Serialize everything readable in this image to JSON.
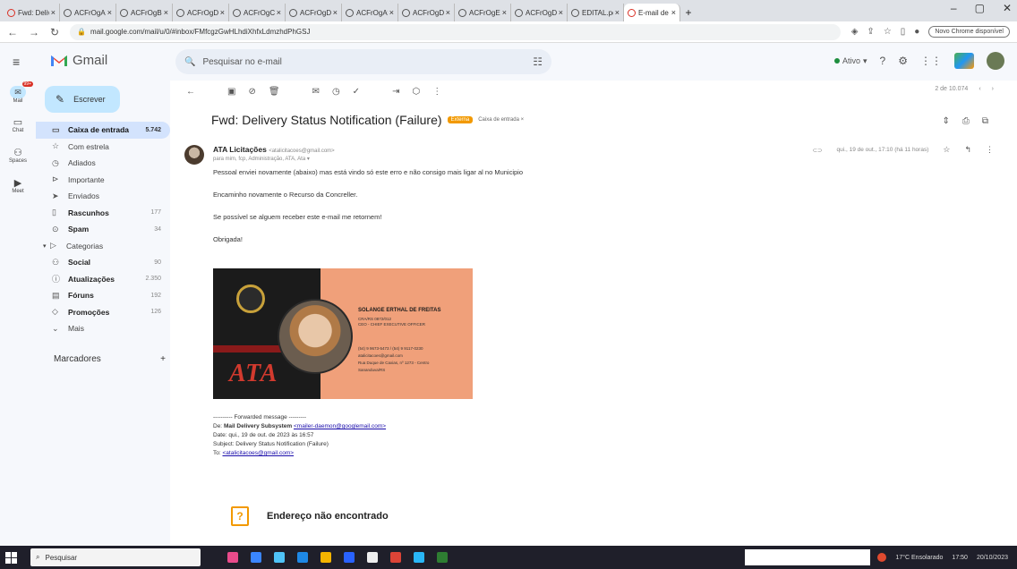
{
  "browser": {
    "tabs": [
      {
        "label": "Fwd: Deliv",
        "icon": "gmail",
        "active": false
      },
      {
        "label": "ACFrOgA7u",
        "icon": "chrome",
        "active": false
      },
      {
        "label": "ACFrOgBe8",
        "icon": "chrome",
        "active": false
      },
      {
        "label": "ACFrOgDsl",
        "icon": "chrome",
        "active": false
      },
      {
        "label": "ACFrOgCsi",
        "icon": "chrome",
        "active": false
      },
      {
        "label": "ACFrOgDxc",
        "icon": "chrome",
        "active": false
      },
      {
        "label": "ACFrOgAfyl",
        "icon": "chrome",
        "active": false
      },
      {
        "label": "ACFrOgDal",
        "icon": "chrome",
        "active": false
      },
      {
        "label": "ACFrOgE6-",
        "icon": "chrome",
        "active": false
      },
      {
        "label": "ACFrOgDfS",
        "icon": "chrome",
        "active": false
      },
      {
        "label": "EDITAL.pdf",
        "icon": "chrome",
        "active": false
      },
      {
        "label": "E-mail de F",
        "icon": "gmail",
        "active": true
      }
    ],
    "url": "mail.google.com/mail/u/0/#inbox/FMfcgzGwHLhdiXhfxLdmzhdPhGSJ",
    "update_label": "Novo Chrome disponível"
  },
  "gmail": {
    "app_name": "Gmail",
    "search_placeholder": "Pesquisar no e-mail",
    "status_label": "Ativo",
    "rail": [
      {
        "label": "Mail",
        "badge": "99+"
      },
      {
        "label": "Chat"
      },
      {
        "label": "Spaces"
      },
      {
        "label": "Meet"
      }
    ],
    "compose_label": "Escrever",
    "nav": [
      {
        "label": "Caixa de entrada",
        "count": "5.742",
        "icon": "inbox-icon",
        "active": true,
        "bold": true
      },
      {
        "label": "Com estrela",
        "count": "",
        "icon": "star-icon"
      },
      {
        "label": "Adiados",
        "count": "",
        "icon": "clock-icon"
      },
      {
        "label": "Importante",
        "count": "",
        "icon": "important-icon"
      },
      {
        "label": "Enviados",
        "count": "",
        "icon": "send-icon"
      },
      {
        "label": "Rascunhos",
        "count": "177",
        "icon": "draft-icon",
        "bold": true
      },
      {
        "label": "Spam",
        "count": "34",
        "icon": "spam-icon",
        "bold": true
      },
      {
        "label": "Categorias",
        "count": "",
        "icon": "label-icon"
      },
      {
        "label": "Social",
        "count": "90",
        "icon": "social-icon",
        "bold": true
      },
      {
        "label": "Atualizações",
        "count": "2.350",
        "icon": "info-icon",
        "bold": true
      },
      {
        "label": "Fóruns",
        "count": "192",
        "icon": "forum-icon",
        "bold": true
      },
      {
        "label": "Promoções",
        "count": "126",
        "icon": "promo-icon",
        "bold": true
      },
      {
        "label": "Mais",
        "count": "",
        "icon": "chevron-down-icon"
      }
    ],
    "labels_heading": "Marcadores"
  },
  "message": {
    "pager": "2 de 10.074",
    "subject": "Fwd: Delivery Status Notification (Failure)",
    "chip": "Externa",
    "inbox_chip": "Caixa de entrada ×",
    "sender_name": "ATA Licitações",
    "sender_email": "<atalicitacoes@gmail.com>",
    "to_line": "para mim, fcp, Administração, ATA, Ata",
    "date": "qui., 19 de out., 17:10 (há 11 horas)",
    "body": [
      "Pessoal enviei novamente (abaixo) mas está vindo só este erro e não consigo mais ligar al no Municipio",
      "Encaminho novamente o Recurso da Concreller.",
      "Se possível se alguem receber este e-mail me retornem!",
      "Obrigada!"
    ],
    "signature": {
      "name": "SOLANGE ERTHAL DE FREITAS",
      "role1": "CRA/RS 0872/012",
      "role2": "CEO - CHIEF EXECUTIVE OFFICER",
      "phone": "(54) 9 9673-5473 / (54) 9 9117-0230",
      "email": "atalicitacoes@gmail.com",
      "address1": "Rua Duque de Caxias, nº 1273 - Centro",
      "address2": "Sananduva/RS",
      "logo_text": "ATA"
    },
    "forward": {
      "header": "---------- Forwarded message ---------",
      "from_label": "De:",
      "from_name": "Mail Delivery Subsystem",
      "from_email": "<mailer-daemon@googlemail.com>",
      "date": "Date: qui., 19 de out. de 2023 às 16:57",
      "subject": "Subject: Delivery Status Notification (Failure)",
      "to_label": "To:",
      "to_email": "<atalicitacoes@gmail.com>"
    },
    "notfound_title": "Endereço não encontrado"
  },
  "taskbar": {
    "search_label": "Pesquisar",
    "weather": "17°C Ensolarado",
    "time": "17:50",
    "date": "20/10/2023"
  },
  "colors": {
    "compose_bg": "#c2e7ff",
    "active_nav": "#d3e3fd",
    "chip": "#f29900",
    "signature_bg": "#f0a07a"
  }
}
